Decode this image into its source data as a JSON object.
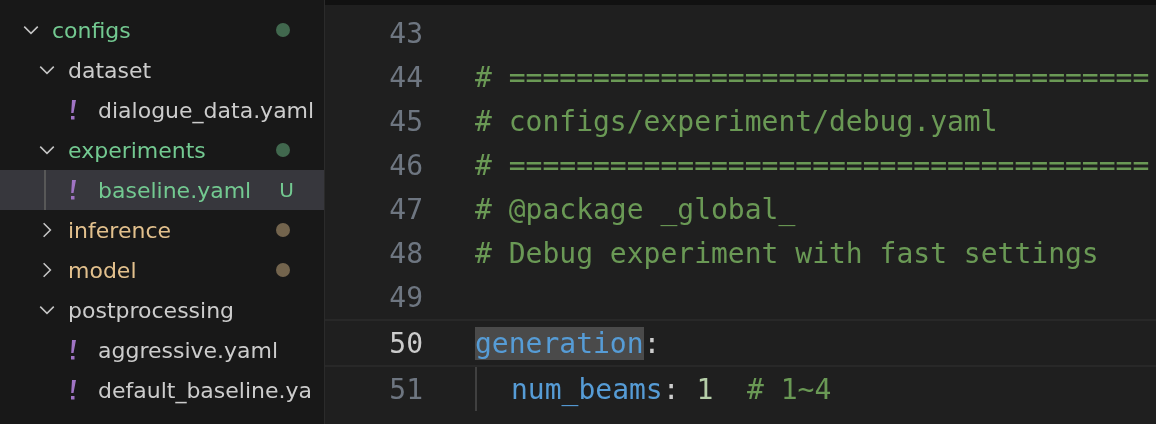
{
  "explorer": {
    "tree": [
      {
        "name": "configs",
        "kind": "folder",
        "expanded": true,
        "color": "#73c991",
        "children": [
          {
            "name": "dataset",
            "kind": "folder",
            "expanded": true,
            "children": [
              {
                "name": "dialogue_data.yaml",
                "kind": "file",
                "selected": false
              }
            ]
          },
          {
            "name": "experiments",
            "kind": "folder",
            "expanded": true,
            "color": "#73c991",
            "children": [
              {
                "name": "baseline.yaml",
                "kind": "file",
                "selected": true,
                "color": "#73c991",
                "badge": "U"
              }
            ]
          },
          {
            "name": "inference",
            "kind": "folder",
            "expanded": false,
            "color": "#e2c08d"
          },
          {
            "name": "model",
            "kind": "folder",
            "expanded": false,
            "color": "#e2c08d"
          },
          {
            "name": "postprocessing",
            "kind": "folder",
            "expanded": true,
            "children": [
              {
                "name": "aggressive.yaml",
                "kind": "file",
                "selected": false
              },
              {
                "name": "default_baseline.ya",
                "kind": "file",
                "selected": false
              }
            ]
          }
        ]
      }
    ]
  },
  "editor": {
    "lines": [
      {
        "number": "43",
        "current": false
      },
      {
        "number": "44",
        "current": false,
        "tokens": [
          {
            "kind": "comment",
            "text": "# ======================================"
          }
        ]
      },
      {
        "number": "45",
        "current": false,
        "tokens": [
          {
            "kind": "comment",
            "text": "# configs/experiment/debug.yaml"
          }
        ]
      },
      {
        "number": "46",
        "current": false,
        "tokens": [
          {
            "kind": "comment",
            "text": "# ======================================"
          }
        ]
      },
      {
        "number": "47",
        "current": false,
        "tokens": [
          {
            "kind": "comment",
            "text": "# @package _global_"
          }
        ]
      },
      {
        "number": "48",
        "current": false,
        "tokens": [
          {
            "kind": "comment",
            "text": "# Debug experiment with fast settings"
          }
        ]
      },
      {
        "number": "49",
        "current": false
      },
      {
        "number": "50",
        "current": true,
        "tokens": [
          {
            "kind": "key",
            "text": "generation",
            "highlighted": true
          },
          {
            "kind": "punct",
            "text": ":"
          }
        ]
      },
      {
        "number": "51",
        "current": false,
        "indent": true,
        "tokens": [
          {
            "kind": "key",
            "text": "num_beams"
          },
          {
            "kind": "punct",
            "text": ": "
          },
          {
            "kind": "number",
            "text": "1"
          },
          {
            "kind": "comment",
            "text": "  # 1~4"
          }
        ]
      }
    ]
  }
}
